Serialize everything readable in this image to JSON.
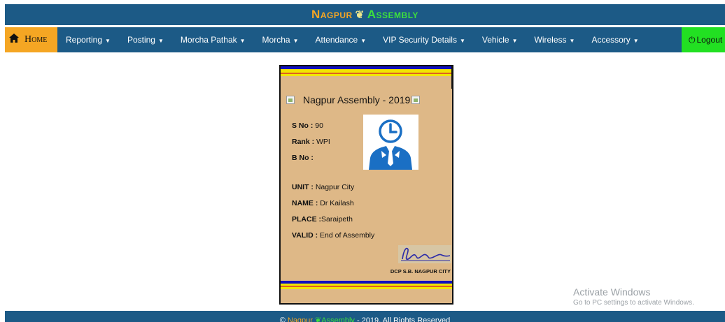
{
  "header": {
    "brand_word1": "Nagpur",
    "brand_word2": "Assembly",
    "brand_icon": "leaf-emblem-icon"
  },
  "nav": {
    "home_label": "Home",
    "items": [
      "Reporting",
      "Posting",
      "Morcha Pathak",
      "Morcha",
      "Attendance",
      "VIP Security Details",
      "Vehicle",
      "Wireless",
      "Accessory"
    ],
    "logout_label": "Logout"
  },
  "card": {
    "title": "Nagpur Assembly - 2019",
    "sno_label": "S No :",
    "sno_value": " 90",
    "rank_label": "Rank :",
    "rank_value": " WPI",
    "bno_label": "B No :",
    "bno_value": "",
    "unit_label": "UNIT :",
    "unit_value": " Nagpur City",
    "name_label": "NAME :",
    "name_value": " Dr Kailash",
    "place_label": "PLACE :",
    "place_value": "Saraipeth",
    "valid_label": "VALID :",
    "valid_value": " End of Assembly",
    "issuer": "DCP S.B. NAGPUR CITY"
  },
  "watermark": {
    "line1": "Activate Windows",
    "line2": "Go to PC settings to activate Windows."
  },
  "footer": {
    "prefix": "© ",
    "word1": "Nagpur",
    "word2": "Assembly",
    "suffix": " - 2019, All Rights Reserved"
  },
  "colors": {
    "nav_bg": "#1c5a86",
    "home_bg": "#f5a623",
    "logout_bg": "#22e022",
    "card_bg": "#deb887",
    "brand_orange": "#f5a623",
    "brand_green": "#3de03d"
  }
}
